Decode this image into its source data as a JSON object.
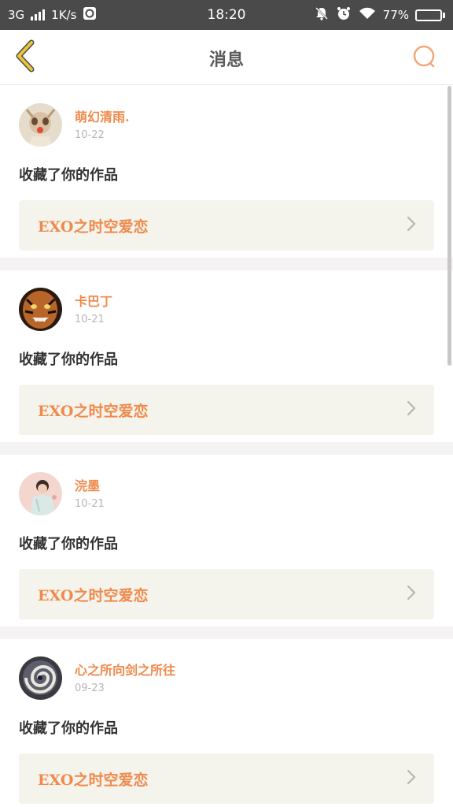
{
  "status_bar": {
    "network": "3G",
    "speed": "1K/s",
    "time": "18:20",
    "battery": "77%",
    "battery_level": 0.77,
    "icons": [
      "signal-icon",
      "wechat-icon",
      "bell-off-icon",
      "alarm-icon",
      "wifi-icon",
      "battery-icon"
    ]
  },
  "nav": {
    "title": "消息",
    "back_icon": "chevron-left-icon",
    "search_icon": "search-icon"
  },
  "colors": {
    "accent": "#ef8a4c",
    "back_icon": "#e8c53a",
    "status_bg": "#4a4a4a",
    "card_link_bg": "#f4f4ed"
  },
  "messages": [
    {
      "username": "萌幻清雨.",
      "date": "10-22",
      "action": "收藏了你的作品",
      "work_title": "EXO之时空爱恋"
    },
    {
      "username": "卡巴丁",
      "date": "10-21",
      "action": "收藏了你的作品",
      "work_title": "EXO之时空爱恋"
    },
    {
      "username": "浣墨",
      "date": "10-21",
      "action": "收藏了你的作品",
      "work_title": "EXO之时空爱恋"
    },
    {
      "username": "心之所向剑之所往",
      "date": "09-23",
      "action": "收藏了你的作品",
      "work_title": "EXO之时空爱恋"
    }
  ]
}
